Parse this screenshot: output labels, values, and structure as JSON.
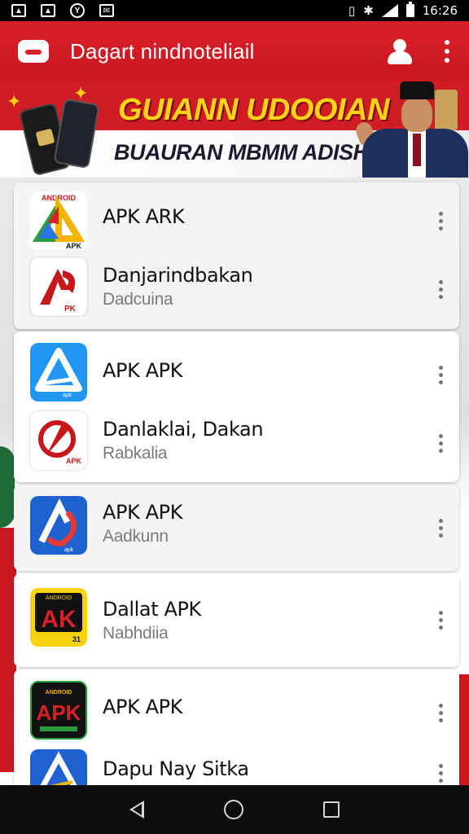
{
  "status_bar": {
    "time": "16:26",
    "icons": [
      "photo-icon",
      "gallery-icon",
      "yahoo-icon",
      "mail-icon",
      "vibrate-icon",
      "bluetooth-icon",
      "wifi-icon",
      "signal-icon",
      "battery-icon"
    ]
  },
  "app_bar": {
    "title": "Dagart nindnoteliail"
  },
  "banner": {
    "headline": "GUIANN UDOOIAN",
    "subline": "BUAURAN MBMM ADISH"
  },
  "list": [
    {
      "title": "APK ARK",
      "subtitle": "",
      "icon_name": "apk-triangle-icon"
    },
    {
      "title": "Danjarindbakan",
      "subtitle": "Dadcuina",
      "icon_name": "apk-red-a-icon"
    },
    {
      "title": "APK  APK",
      "subtitle": "",
      "icon_name": "apk-blue-a-icon"
    },
    {
      "title": "Danlaklai, Dakan",
      "subtitle": "Rabkalia",
      "icon_name": "apk-red-swirl-icon"
    },
    {
      "title": "APK  APK",
      "subtitle": "Aadkunn",
      "icon_name": "apk-blue-swirl-icon"
    },
    {
      "title": "Dallat APK",
      "subtitle": "Nabhdiia",
      "icon_name": "apk-yellow-icon"
    },
    {
      "title": "APK  APK",
      "subtitle": "",
      "icon_name": "apk-black-icon"
    },
    {
      "title": "Dapu Nay Sitka",
      "subtitle": "",
      "icon_name": "apk-blue-a-icon"
    }
  ],
  "colors": {
    "primary_red": "#d9202a",
    "banner_yellow": "#ffd21a"
  }
}
